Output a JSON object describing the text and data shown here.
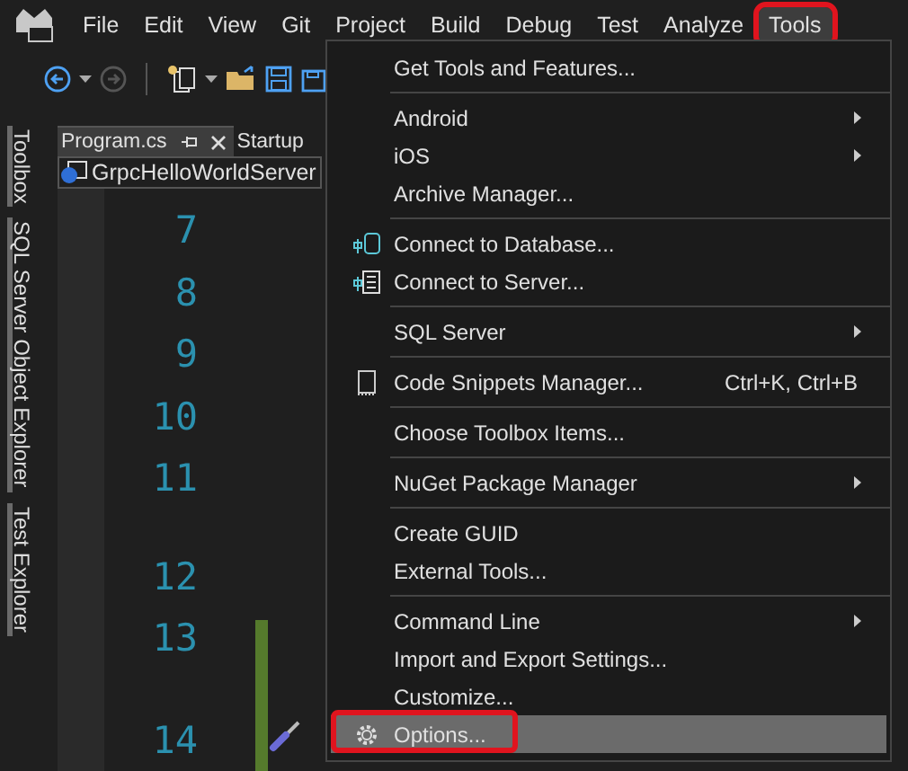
{
  "menu_bar": {
    "items": [
      {
        "label": "File",
        "selected": false
      },
      {
        "label": "Edit",
        "selected": false
      },
      {
        "label": "View",
        "selected": false
      },
      {
        "label": "Git",
        "selected": false
      },
      {
        "label": "Project",
        "selected": false
      },
      {
        "label": "Build",
        "selected": false
      },
      {
        "label": "Debug",
        "selected": false
      },
      {
        "label": "Test",
        "selected": false
      },
      {
        "label": "Analyze",
        "selected": false
      },
      {
        "label": "Tools",
        "selected": true
      }
    ]
  },
  "side_tabs": [
    {
      "label": "Toolbox"
    },
    {
      "label": "SQL Server Object Explorer"
    },
    {
      "label": "Test Explorer"
    }
  ],
  "doc_tabs": [
    {
      "label": "Program.cs",
      "selected": true
    },
    {
      "label": "Startup",
      "selected": false
    }
  ],
  "nav_bar": {
    "project": "GrpcHelloWorldServer"
  },
  "line_numbers": [
    "7",
    "8",
    "9",
    "10",
    "11",
    "12",
    "13",
    "14"
  ],
  "tools_menu": [
    {
      "kind": "plain",
      "label": "Get Tools and Features...",
      "submenu": false,
      "highlighted": false
    },
    {
      "kind": "separator"
    },
    {
      "kind": "plain",
      "label": "Android",
      "submenu": true,
      "highlighted": false
    },
    {
      "kind": "plain",
      "label": "iOS",
      "submenu": true,
      "highlighted": false
    },
    {
      "kind": "plain",
      "label": "Archive Manager...",
      "submenu": false,
      "highlighted": false
    },
    {
      "kind": "separator"
    },
    {
      "kind": "database",
      "label": "Connect to Database...",
      "submenu": false,
      "highlighted": false
    },
    {
      "kind": "server",
      "label": "Connect to Server...",
      "submenu": false,
      "highlighted": false
    },
    {
      "kind": "separator"
    },
    {
      "kind": "plain",
      "label": "SQL Server",
      "submenu": true,
      "highlighted": false
    },
    {
      "kind": "separator"
    },
    {
      "kind": "snippet",
      "label": "Code Snippets Manager...",
      "shortcut": "Ctrl+K, Ctrl+B",
      "submenu": false,
      "highlighted": false
    },
    {
      "kind": "separator"
    },
    {
      "kind": "plain",
      "label": "Choose Toolbox Items...",
      "submenu": false,
      "highlighted": false
    },
    {
      "kind": "separator"
    },
    {
      "kind": "plain",
      "label": "NuGet Package Manager",
      "submenu": true,
      "highlighted": false
    },
    {
      "kind": "separator"
    },
    {
      "kind": "plain",
      "label": "Create GUID",
      "submenu": false,
      "highlighted": false
    },
    {
      "kind": "plain",
      "label": "External Tools...",
      "submenu": false,
      "highlighted": false
    },
    {
      "kind": "separator"
    },
    {
      "kind": "plain",
      "label": "Command Line",
      "submenu": true,
      "highlighted": false
    },
    {
      "kind": "plain",
      "label": "Import and Export Settings...",
      "submenu": false,
      "highlighted": false
    },
    {
      "kind": "plain",
      "label": "Customize...",
      "submenu": false,
      "highlighted": false
    },
    {
      "kind": "gear",
      "label": "Options...",
      "submenu": false,
      "highlighted": true
    }
  ]
}
